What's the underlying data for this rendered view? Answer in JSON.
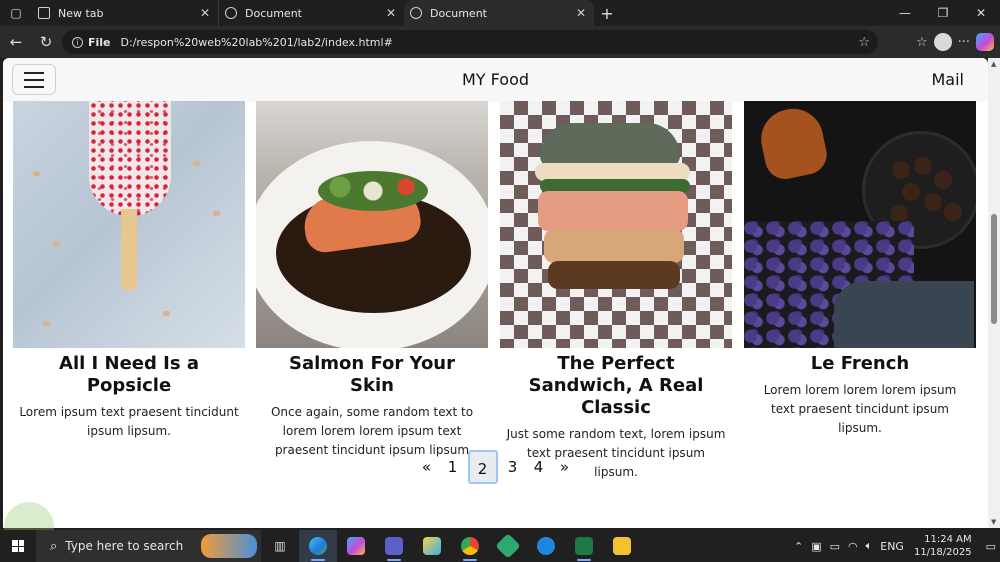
{
  "browser": {
    "tabs": [
      {
        "title": "New tab",
        "active": false
      },
      {
        "title": "Document",
        "active": false
      },
      {
        "title": "Document",
        "active": true
      }
    ],
    "address": {
      "scheme": "File",
      "url": "D:/respon%20web%20lab%201/lab2/index.html#"
    }
  },
  "site": {
    "brand": "MY Food",
    "mail_link": "Mail",
    "cards": [
      {
        "title": "All I Need Is a Popsicle",
        "text": "Lorem ipsum text praesent tincidunt ipsum lipsum."
      },
      {
        "title": "Salmon For Your Skin",
        "text": "Once again, some random text to lorem lorem lorem ipsum text praesent tincidunt ipsum lipsum"
      },
      {
        "title": "The Perfect Sandwich, A Real Classic",
        "text": "Just some random text, lorem ipsum text praesent tincidunt ipsum lipsum."
      },
      {
        "title": "Le French",
        "text": "Lorem lorem lorem lorem ipsum text praesent tincidunt ipsum lipsum."
      }
    ],
    "pagination": {
      "prev": "«",
      "pages": [
        "1",
        "2",
        "3",
        "4"
      ],
      "active": "2",
      "next": "»"
    }
  },
  "taskbar": {
    "search_placeholder": "Type here to search",
    "language": "ENG",
    "time": "11:24 AM",
    "date": "11/18/2025"
  },
  "colors": {
    "accent_focus": "#9cc4ff",
    "page_bg": "#ffffff",
    "nav_bg": "#f8f8f8"
  }
}
